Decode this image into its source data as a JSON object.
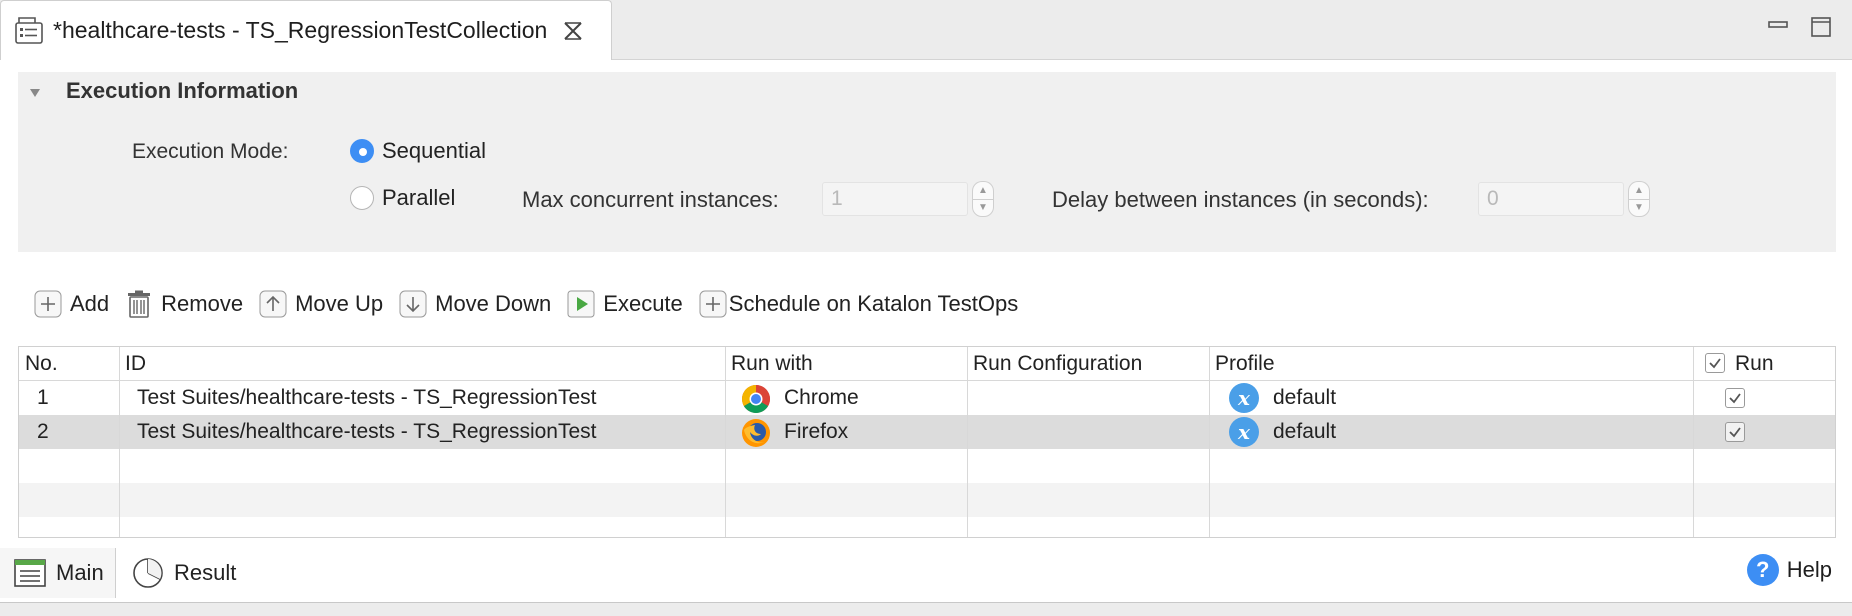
{
  "editor_tab": {
    "title": "*healthcare-tests - TS_RegressionTestCollection",
    "icon": "test-suite-collection-icon"
  },
  "window_controls": {
    "minimize": "minimize-icon",
    "maximize": "maximize-icon"
  },
  "execution": {
    "section_title": "Execution Information",
    "mode_label": "Execution Mode:",
    "modes": [
      {
        "label": "Sequential",
        "checked": true
      },
      {
        "label": "Parallel",
        "checked": false
      }
    ],
    "max_concurrent_label": "Max concurrent instances:",
    "max_concurrent_value": "1",
    "delay_label": "Delay between instances (in seconds):",
    "delay_value": "0"
  },
  "toolbar": {
    "add": "Add",
    "remove": "Remove",
    "move_up": "Move Up",
    "move_down": "Move Down",
    "execute": "Execute",
    "schedule": "Schedule on Katalon TestOps"
  },
  "table": {
    "columns": [
      "No.",
      "ID",
      "Run with",
      "Run Configuration",
      "Profile",
      "Run"
    ],
    "rows": [
      {
        "no": "1",
        "id": "Test Suites/healthcare-tests - TS_RegressionTest",
        "run_with": "Chrome",
        "run_with_icon": "chrome-icon",
        "run_configuration": "",
        "profile": "default",
        "run": true
      },
      {
        "no": "2",
        "id": "Test Suites/healthcare-tests - TS_RegressionTest",
        "run_with": "Firefox",
        "run_with_icon": "firefox-icon",
        "run_configuration": "",
        "profile": "default",
        "run": true
      }
    ]
  },
  "bottom_tabs": {
    "main": "Main",
    "result": "Result",
    "help": "Help"
  },
  "colors": {
    "accent": "#3d8ef4",
    "profile_icon": "#4a9fe8",
    "selected_row": "#dcdcdc"
  }
}
